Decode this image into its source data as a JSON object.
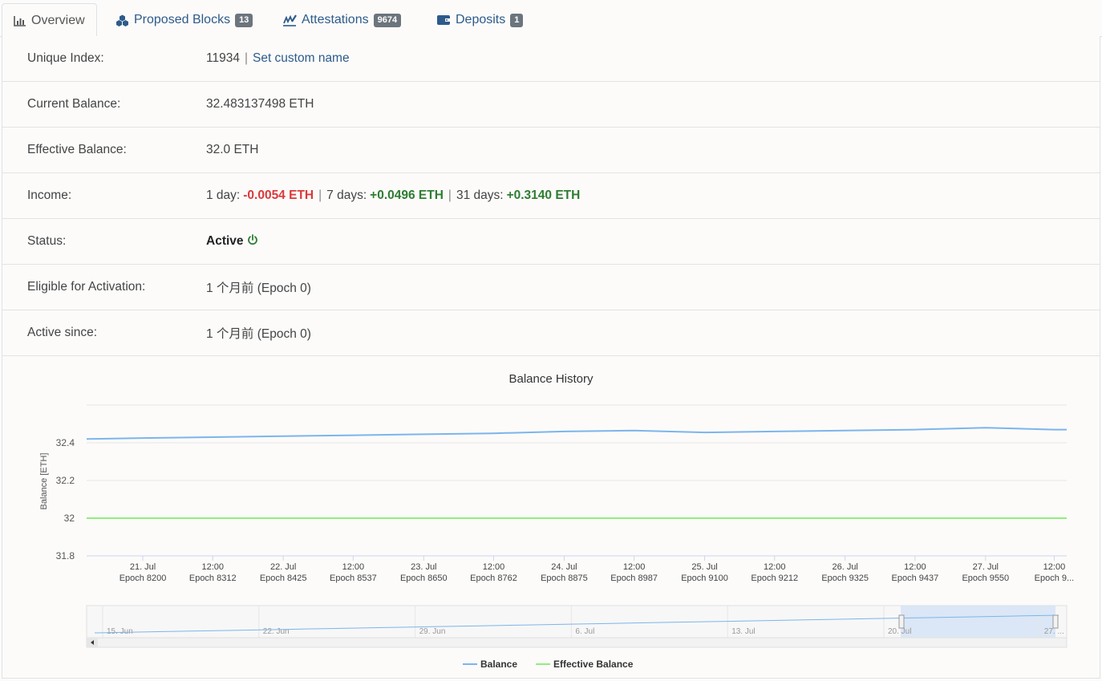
{
  "tabs": [
    {
      "label": "Overview",
      "icon": "bar-chart-icon",
      "badge": null,
      "active": true
    },
    {
      "label": "Proposed Blocks",
      "icon": "cubes-icon",
      "badge": "13",
      "active": false
    },
    {
      "label": "Attestations",
      "icon": "signature-icon",
      "badge": "9674",
      "active": false
    },
    {
      "label": "Deposits",
      "icon": "wallet-icon",
      "badge": "1",
      "active": false
    }
  ],
  "details": {
    "unique_index": {
      "label": "Unique Index:",
      "value": "11934",
      "link": "Set custom name"
    },
    "current_balance": {
      "label": "Current Balance:",
      "value": "32.483137498 ETH"
    },
    "effective_balance": {
      "label": "Effective Balance:",
      "value": "32.0 ETH"
    },
    "income": {
      "label": "Income:",
      "d1_label": "1 day:",
      "d1_value": "-0.0054 ETH",
      "d7_label": "7 days:",
      "d7_value": "+0.0496 ETH",
      "d31_label": "31 days:",
      "d31_value": "+0.3140 ETH"
    },
    "status": {
      "label": "Status:",
      "value": "Active",
      "icon": "power-icon"
    },
    "eligible": {
      "label": "Eligible for Activation:",
      "value": "1 个月前 (Epoch 0)"
    },
    "active_since": {
      "label": "Active since:",
      "value": "1 个月前 (Epoch 0)"
    }
  },
  "colors": {
    "balance": "#7cb5ec",
    "effective_balance": "#90ed7d",
    "negative": "#d93a3a",
    "positive": "#2e7d32",
    "link": "#2d5b8a"
  },
  "chart_data": {
    "type": "line",
    "title": "Balance History",
    "ylabel": "Balance [ETH]",
    "ylim": [
      31.8,
      32.6
    ],
    "y_ticks": [
      "32.4",
      "32.2",
      "32",
      "31.8"
    ],
    "y_tick_values": [
      32.4,
      32.2,
      32.0,
      31.8
    ],
    "x_ticks": [
      {
        "date": "21. Jul",
        "epoch": "Epoch 8200"
      },
      {
        "date": "12:00",
        "epoch": "Epoch 8312"
      },
      {
        "date": "22. Jul",
        "epoch": "Epoch 8425"
      },
      {
        "date": "12:00",
        "epoch": "Epoch 8537"
      },
      {
        "date": "23. Jul",
        "epoch": "Epoch 8650"
      },
      {
        "date": "12:00",
        "epoch": "Epoch 8762"
      },
      {
        "date": "24. Jul",
        "epoch": "Epoch 8875"
      },
      {
        "date": "12:00",
        "epoch": "Epoch 8987"
      },
      {
        "date": "25. Jul",
        "epoch": "Epoch 9100"
      },
      {
        "date": "12:00",
        "epoch": "Epoch 9212"
      },
      {
        "date": "26. Jul",
        "epoch": "Epoch 9325"
      },
      {
        "date": "12:00",
        "epoch": "Epoch 9437"
      },
      {
        "date": "27. Jul",
        "epoch": "Epoch 9550"
      },
      {
        "date": "12:00",
        "epoch": "Epoch 9..."
      }
    ],
    "x_epochs": [
      8110,
      8200,
      8312,
      8425,
      8537,
      8650,
      8762,
      8875,
      8987,
      9100,
      9212,
      9325,
      9437,
      9550,
      9660,
      9680
    ],
    "series": [
      {
        "name": "Balance",
        "values": [
          32.42,
          32.425,
          32.43,
          32.435,
          32.44,
          32.445,
          32.45,
          32.46,
          32.465,
          32.455,
          32.46,
          32.465,
          32.47,
          32.48,
          32.47,
          32.47
        ]
      },
      {
        "name": "Effective Balance",
        "values": [
          32.0,
          32.0,
          32.0,
          32.0,
          32.0,
          32.0,
          32.0,
          32.0,
          32.0,
          32.0,
          32.0,
          32.0,
          32.0,
          32.0,
          32.0,
          32.0
        ]
      }
    ],
    "navigator": {
      "labels": [
        "15. Jun",
        "22. Jun",
        "29. Jun",
        "6. Jul",
        "13. Jul",
        "20. Jul",
        "27. ..."
      ]
    },
    "legend": [
      "Balance",
      "Effective Balance"
    ],
    "legend_position": "bottom-center"
  }
}
